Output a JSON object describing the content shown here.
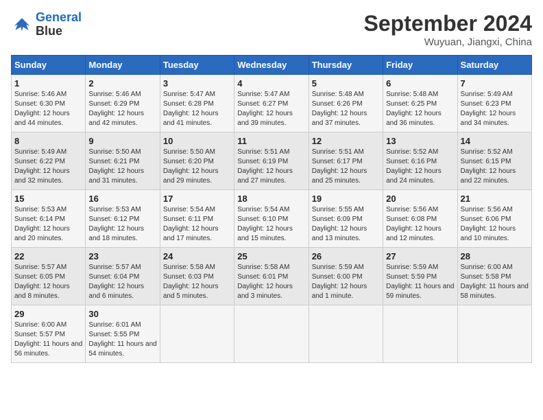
{
  "header": {
    "logo_line1": "General",
    "logo_line2": "Blue",
    "month": "September 2024",
    "location": "Wuyuan, Jiangxi, China"
  },
  "weekdays": [
    "Sunday",
    "Monday",
    "Tuesday",
    "Wednesday",
    "Thursday",
    "Friday",
    "Saturday"
  ],
  "weeks": [
    [
      {
        "day": "1",
        "sunrise": "5:46 AM",
        "sunset": "6:30 PM",
        "daylight": "12 hours and 44 minutes."
      },
      {
        "day": "2",
        "sunrise": "5:46 AM",
        "sunset": "6:29 PM",
        "daylight": "12 hours and 42 minutes."
      },
      {
        "day": "3",
        "sunrise": "5:47 AM",
        "sunset": "6:28 PM",
        "daylight": "12 hours and 41 minutes."
      },
      {
        "day": "4",
        "sunrise": "5:47 AM",
        "sunset": "6:27 PM",
        "daylight": "12 hours and 39 minutes."
      },
      {
        "day": "5",
        "sunrise": "5:48 AM",
        "sunset": "6:26 PM",
        "daylight": "12 hours and 37 minutes."
      },
      {
        "day": "6",
        "sunrise": "5:48 AM",
        "sunset": "6:25 PM",
        "daylight": "12 hours and 36 minutes."
      },
      {
        "day": "7",
        "sunrise": "5:49 AM",
        "sunset": "6:23 PM",
        "daylight": "12 hours and 34 minutes."
      }
    ],
    [
      {
        "day": "8",
        "sunrise": "5:49 AM",
        "sunset": "6:22 PM",
        "daylight": "12 hours and 32 minutes."
      },
      {
        "day": "9",
        "sunrise": "5:50 AM",
        "sunset": "6:21 PM",
        "daylight": "12 hours and 31 minutes."
      },
      {
        "day": "10",
        "sunrise": "5:50 AM",
        "sunset": "6:20 PM",
        "daylight": "12 hours and 29 minutes."
      },
      {
        "day": "11",
        "sunrise": "5:51 AM",
        "sunset": "6:19 PM",
        "daylight": "12 hours and 27 minutes."
      },
      {
        "day": "12",
        "sunrise": "5:51 AM",
        "sunset": "6:17 PM",
        "daylight": "12 hours and 25 minutes."
      },
      {
        "day": "13",
        "sunrise": "5:52 AM",
        "sunset": "6:16 PM",
        "daylight": "12 hours and 24 minutes."
      },
      {
        "day": "14",
        "sunrise": "5:52 AM",
        "sunset": "6:15 PM",
        "daylight": "12 hours and 22 minutes."
      }
    ],
    [
      {
        "day": "15",
        "sunrise": "5:53 AM",
        "sunset": "6:14 PM",
        "daylight": "12 hours and 20 minutes."
      },
      {
        "day": "16",
        "sunrise": "5:53 AM",
        "sunset": "6:12 PM",
        "daylight": "12 hours and 18 minutes."
      },
      {
        "day": "17",
        "sunrise": "5:54 AM",
        "sunset": "6:11 PM",
        "daylight": "12 hours and 17 minutes."
      },
      {
        "day": "18",
        "sunrise": "5:54 AM",
        "sunset": "6:10 PM",
        "daylight": "12 hours and 15 minutes."
      },
      {
        "day": "19",
        "sunrise": "5:55 AM",
        "sunset": "6:09 PM",
        "daylight": "12 hours and 13 minutes."
      },
      {
        "day": "20",
        "sunrise": "5:56 AM",
        "sunset": "6:08 PM",
        "daylight": "12 hours and 12 minutes."
      },
      {
        "day": "21",
        "sunrise": "5:56 AM",
        "sunset": "6:06 PM",
        "daylight": "12 hours and 10 minutes."
      }
    ],
    [
      {
        "day": "22",
        "sunrise": "5:57 AM",
        "sunset": "6:05 PM",
        "daylight": "12 hours and 8 minutes."
      },
      {
        "day": "23",
        "sunrise": "5:57 AM",
        "sunset": "6:04 PM",
        "daylight": "12 hours and 6 minutes."
      },
      {
        "day": "24",
        "sunrise": "5:58 AM",
        "sunset": "6:03 PM",
        "daylight": "12 hours and 5 minutes."
      },
      {
        "day": "25",
        "sunrise": "5:58 AM",
        "sunset": "6:01 PM",
        "daylight": "12 hours and 3 minutes."
      },
      {
        "day": "26",
        "sunrise": "5:59 AM",
        "sunset": "6:00 PM",
        "daylight": "12 hours and 1 minute."
      },
      {
        "day": "27",
        "sunrise": "5:59 AM",
        "sunset": "5:59 PM",
        "daylight": "11 hours and 59 minutes."
      },
      {
        "day": "28",
        "sunrise": "6:00 AM",
        "sunset": "5:58 PM",
        "daylight": "11 hours and 58 minutes."
      }
    ],
    [
      {
        "day": "29",
        "sunrise": "6:00 AM",
        "sunset": "5:57 PM",
        "daylight": "11 hours and 56 minutes."
      },
      {
        "day": "30",
        "sunrise": "6:01 AM",
        "sunset": "5:55 PM",
        "daylight": "11 hours and 54 minutes."
      },
      null,
      null,
      null,
      null,
      null
    ]
  ]
}
